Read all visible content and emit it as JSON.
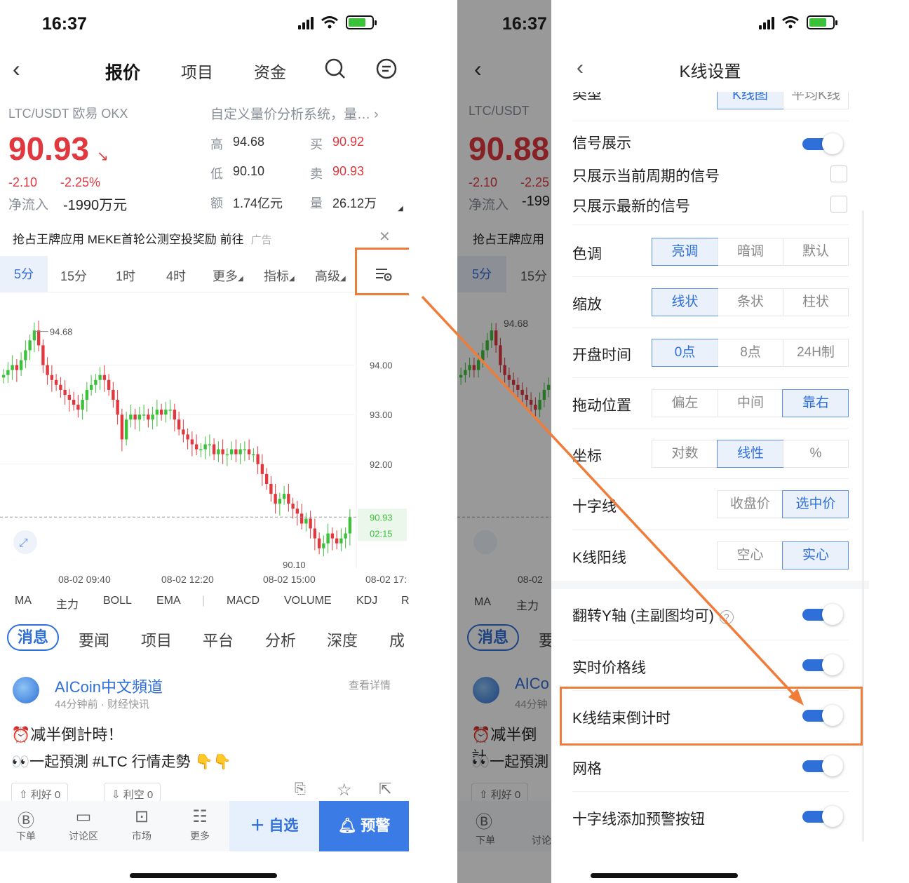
{
  "status": {
    "time": "16:37"
  },
  "left": {
    "nav": {
      "tabs": [
        "报价",
        "项目",
        "资金"
      ]
    },
    "pair": "LTC/USDT  欧易 OKX",
    "description": "自定义量价分析系统，量…",
    "price": "90.93",
    "change_abs": "-2.10",
    "change_pct": "-2.25%",
    "inflow_label": "净流入",
    "inflow_value": "-1990万元",
    "stats": {
      "high_label": "高",
      "high": "94.68",
      "low_label": "低",
      "low": "90.10",
      "amount_label": "额",
      "amount": "1.74亿元",
      "buy_label": "买",
      "buy": "90.92",
      "sell_label": "卖",
      "sell": "90.93",
      "volume_label": "量",
      "volume": "26.12万"
    },
    "ad": {
      "text": "抢占王牌应用 MEKE首轮公测空投奖励 前往",
      "tag": "广告"
    },
    "periods": [
      "5分",
      "15分",
      "1时",
      "4时",
      "更多",
      "指标",
      "高级"
    ],
    "chart_data": {
      "type": "candlestick",
      "x_ticks": [
        "08-02 09:40",
        "08-02 12:20",
        "08-02 15:00",
        "08-02 17:"
      ],
      "y_ticks": [
        "94.00",
        "93.00",
        "92.00"
      ],
      "high_label": "94.68",
      "low_label": "90.10",
      "current_price": "90.93",
      "countdown": "02:15",
      "ylim": [
        89.9,
        95.0
      ],
      "closes": [
        93.8,
        93.9,
        94.0,
        93.9,
        94.1,
        94.3,
        94.5,
        94.7,
        94.4,
        94.0,
        93.8,
        93.7,
        93.6,
        93.5,
        93.4,
        93.3,
        93.2,
        93.1,
        93.3,
        93.5,
        93.6,
        93.7,
        93.8,
        93.7,
        93.5,
        93.3,
        93.0,
        92.5,
        92.9,
        93.0,
        92.9,
        93.0,
        93.0,
        92.9,
        93.0,
        93.1,
        93.0,
        93.1,
        93.1,
        92.9,
        92.7,
        92.6,
        92.5,
        92.4,
        92.3,
        92.3,
        92.4,
        92.4,
        92.2,
        92.3,
        92.2,
        92.2,
        92.3,
        92.2,
        92.3,
        92.3,
        92.2,
        92.2,
        92.0,
        91.8,
        91.6,
        91.4,
        91.2,
        91.3,
        91.4,
        91.2,
        91.1,
        91.0,
        90.8,
        90.9,
        90.7,
        90.5,
        90.3,
        90.4,
        90.6,
        90.5,
        90.4,
        90.5,
        90.6,
        90.93
      ]
    },
    "indicators": [
      "MA",
      "主力",
      "BOLL",
      "EMA",
      "MACD",
      "VOLUME",
      "KDJ",
      "R"
    ],
    "news_tabs": [
      "消息",
      "要闻",
      "项目",
      "平台",
      "分析",
      "深度",
      "成"
    ],
    "post": {
      "author": "AICoin中文頻道",
      "meta": "44分钟前 · 财经快讯",
      "detail": "查看详情",
      "line1": "⏰减半倒計時！",
      "line2": "👀一起預測 #LTC 行情走勢 👇👇",
      "bull": "利好 0",
      "bear": "利空 0"
    },
    "bottom": {
      "items": [
        "下单",
        "讨论区",
        "市场",
        "更多"
      ],
      "fav": "＋ 自选",
      "alert": "预警"
    }
  },
  "right": {
    "title": "K线设置",
    "peek": {
      "pair": "LTC/USDT",
      "price": "90.88",
      "change_abs": "-2.10",
      "change_pct": "-2.25",
      "inflow": "净流入",
      "inflow_v": "-199",
      "ad": "抢占王牌应用",
      "p5": "5分",
      "p15": "15分",
      "hi": "94.68",
      "xt": "08-02",
      "ind1": "MA",
      "ind2": "主力",
      "news": "消息",
      "news2": "要",
      "author": "AICo",
      "meta": "44分钟",
      "line1": "⏰减半倒計",
      "line2": "👀一起預測",
      "bull": "利好 0",
      "b1": "下单",
      "b2": "讨论"
    },
    "type_row": {
      "label": "类型",
      "options": [
        "K线图",
        "平均K线"
      ]
    },
    "signal_show": "信号展示",
    "only_current": "只展示当前周期的信号",
    "only_latest": "只展示最新的信号",
    "tone": {
      "label": "色调",
      "options": [
        "亮调",
        "暗调",
        "默认"
      ],
      "selected": 0
    },
    "zoom": {
      "label": "缩放",
      "options": [
        "线状",
        "条状",
        "柱状"
      ],
      "selected": 0
    },
    "open_time": {
      "label": "开盘时间",
      "options": [
        "0点",
        "8点",
        "24H制"
      ],
      "selected": 0
    },
    "drag": {
      "label": "拖动位置",
      "options": [
        "偏左",
        "中间",
        "靠右"
      ],
      "selected": 2
    },
    "coord": {
      "label": "坐标",
      "options": [
        "对数",
        "线性",
        "%"
      ],
      "selected": 1
    },
    "crosshair": {
      "label": "十字线",
      "options": [
        "收盘价",
        "选中价"
      ],
      "selected": 1
    },
    "bull_candle": {
      "label": "K线阳线",
      "options": [
        "空心",
        "实心"
      ],
      "selected": 1
    },
    "flip_y": "翻转Y轴 (主副图均可)",
    "help": "?",
    "realtime": "实时价格线",
    "countdown": "K线结束倒计时",
    "grid": "网格",
    "cross_alert": "十字线添加预警按钮"
  },
  "colors": {
    "accent": "#2f6fd9",
    "up": "#3cc13b",
    "down": "#e0383e",
    "annotation": "#f07c3a"
  }
}
